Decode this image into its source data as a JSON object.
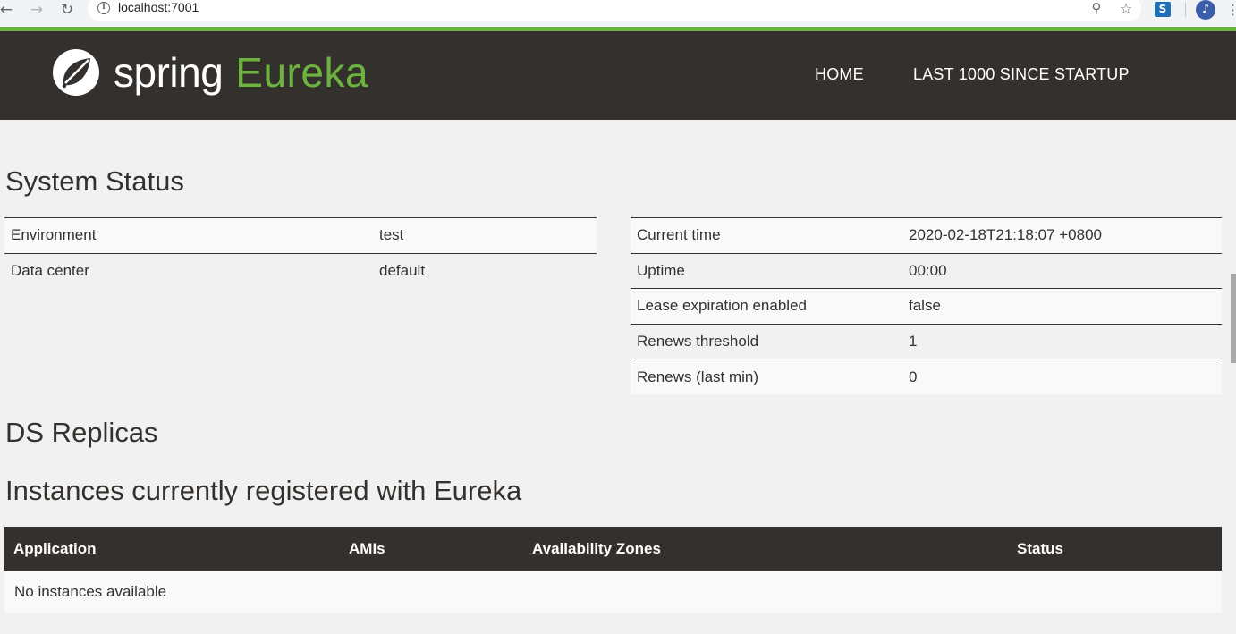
{
  "browser": {
    "url": "localhost:7001",
    "info_glyph": "i",
    "icons": [
      "back-arrow-icon",
      "forward-arrow-icon",
      "reload-icon",
      "info-icon",
      "zoom-icon",
      "star-icon",
      "extension-icon",
      "profile-avatar-icon",
      "menu-dots-icon"
    ]
  },
  "header": {
    "logo_spring": "spring",
    "logo_eureka": "Eureka",
    "nav": [
      {
        "label": "HOME"
      },
      {
        "label": "LAST 1000 SINCE STARTUP"
      }
    ]
  },
  "system_status": {
    "title": "System Status",
    "left": [
      {
        "key": "Environment",
        "value": "test"
      },
      {
        "key": "Data center",
        "value": "default"
      }
    ],
    "right": [
      {
        "key": "Current time",
        "value": "2020-02-18T21:18:07 +0800"
      },
      {
        "key": "Uptime",
        "value": "00:00"
      },
      {
        "key": "Lease expiration enabled",
        "value": "false"
      },
      {
        "key": "Renews threshold",
        "value": "1"
      },
      {
        "key": "Renews (last min)",
        "value": "0"
      }
    ]
  },
  "replicas": {
    "title": "DS Replicas"
  },
  "instances": {
    "title": "Instances currently registered with Eureka",
    "columns": [
      "Application",
      "AMIs",
      "Availability Zones",
      "Status"
    ],
    "empty_message": "No instances available"
  },
  "colors": {
    "brand_dark": "#34302d",
    "brand_green": "#6db33f",
    "page_bg": "#f1f1f1"
  }
}
